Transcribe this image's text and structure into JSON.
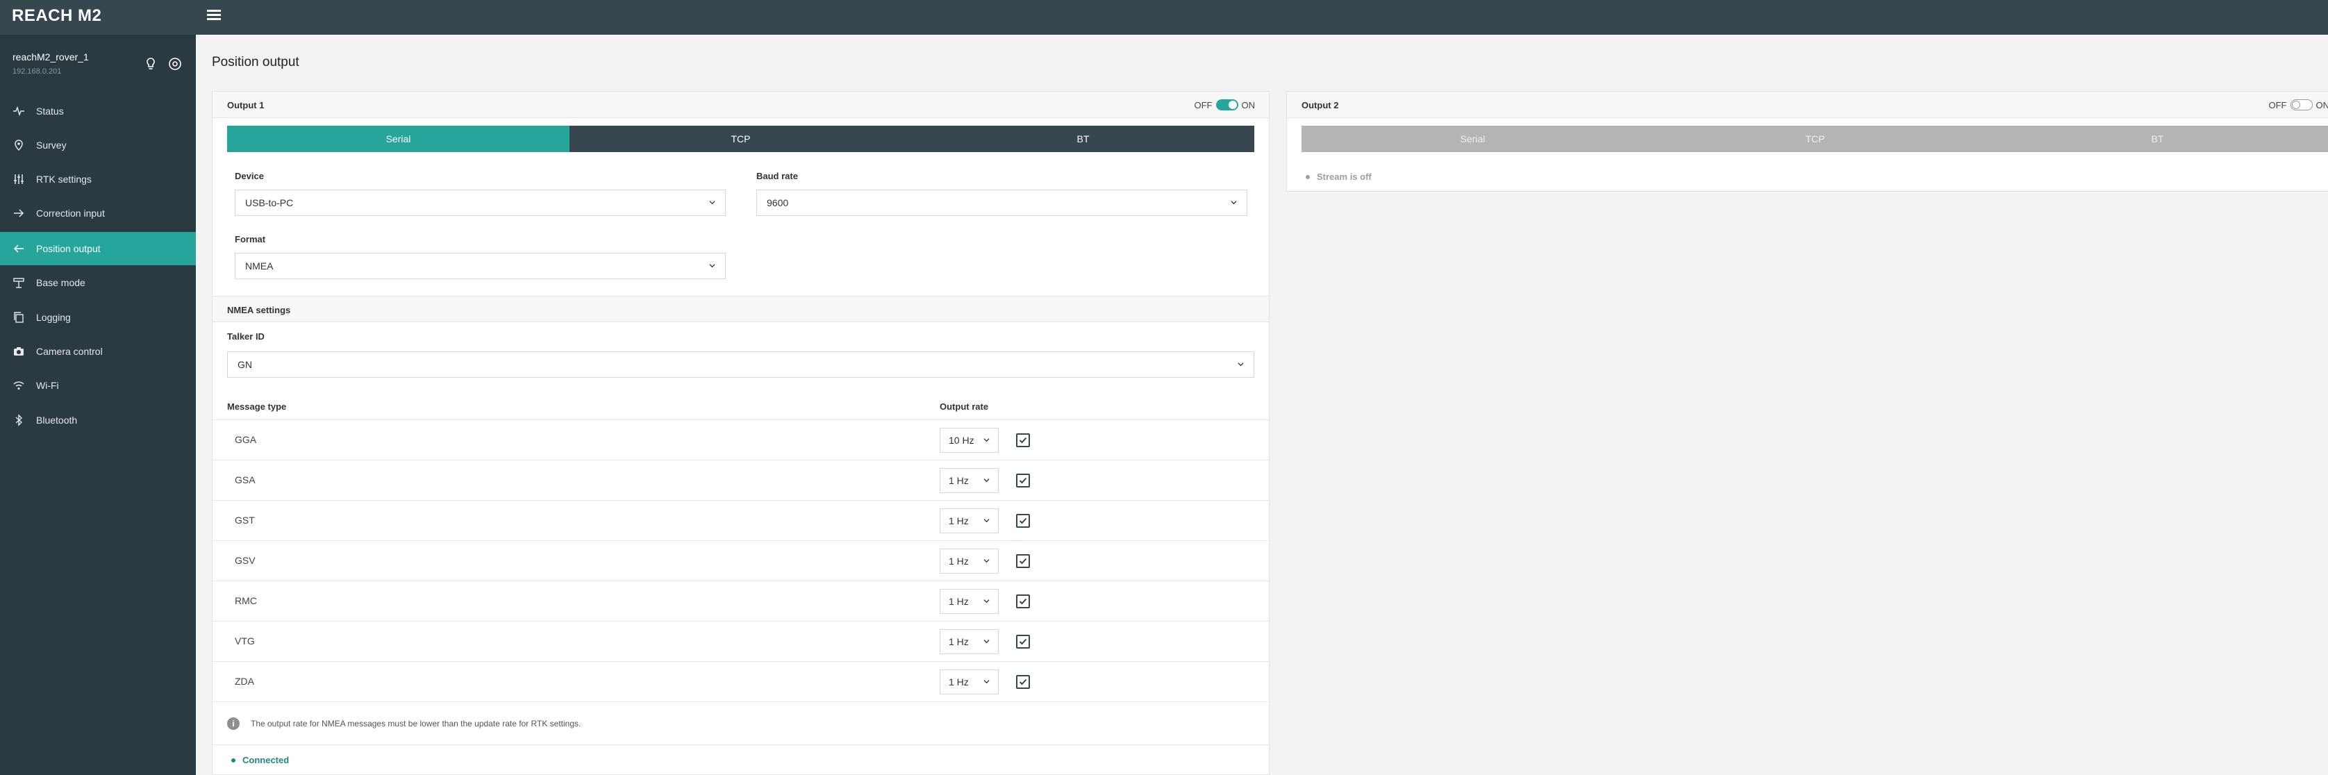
{
  "app": {
    "brand": "REACH M2"
  },
  "device": {
    "name": "reachM2_rover_1",
    "ip": "192.168.0.201"
  },
  "sidebar": {
    "items": [
      {
        "label": "Status",
        "icon": "pulse-icon"
      },
      {
        "label": "Survey",
        "icon": "map-pin-icon"
      },
      {
        "label": "RTK settings",
        "icon": "sliders-icon"
      },
      {
        "label": "Correction input",
        "icon": "arrow-right-icon"
      },
      {
        "label": "Position output",
        "icon": "arrow-left-icon",
        "active": true
      },
      {
        "label": "Base mode",
        "icon": "antenna-icon"
      },
      {
        "label": "Logging",
        "icon": "copy-icon"
      },
      {
        "label": "Camera control",
        "icon": "camera-icon"
      },
      {
        "label": "Wi-Fi",
        "icon": "wifi-icon"
      },
      {
        "label": "Bluetooth",
        "icon": "bluetooth-icon"
      }
    ]
  },
  "main": {
    "title": "Position output"
  },
  "output1": {
    "title": "Output 1",
    "toggle": {
      "off_label": "OFF",
      "on_label": "ON",
      "state": "on"
    },
    "tabs": [
      {
        "label": "Serial",
        "active": true
      },
      {
        "label": "TCP"
      },
      {
        "label": "BT"
      }
    ],
    "device_label": "Device",
    "device_value": "USB-to-PC",
    "baud_label": "Baud rate",
    "baud_value": "9600",
    "format_label": "Format",
    "format_value": "NMEA",
    "nmea_title": "NMEA settings",
    "talker_label": "Talker ID",
    "talker_value": "GN",
    "col_message": "Message type",
    "col_rate": "Output rate",
    "messages": [
      {
        "name": "GGA",
        "rate": "10 Hz",
        "enabled": true
      },
      {
        "name": "GSA",
        "rate": "1 Hz",
        "enabled": true
      },
      {
        "name": "GST",
        "rate": "1 Hz",
        "enabled": true
      },
      {
        "name": "GSV",
        "rate": "1 Hz",
        "enabled": true
      },
      {
        "name": "RMC",
        "rate": "1 Hz",
        "enabled": true
      },
      {
        "name": "VTG",
        "rate": "1 Hz",
        "enabled": true
      },
      {
        "name": "ZDA",
        "rate": "1 Hz",
        "enabled": true
      }
    ],
    "note": "The output rate for NMEA messages must be lower than the update rate for RTK settings.",
    "status": "Connected"
  },
  "output2": {
    "title": "Output 2",
    "toggle": {
      "off_label": "OFF",
      "on_label": "ON",
      "state": "off"
    },
    "tabs": [
      {
        "label": "Serial"
      },
      {
        "label": "TCP"
      },
      {
        "label": "BT"
      }
    ],
    "status": "Stream is off"
  },
  "colors": {
    "accent": "#26a69a",
    "topbar": "#37474f",
    "sidebar": "#2b3a40",
    "tab_dark": "#37474f",
    "tab_disabled": "#b0b0b0",
    "status_ok": "#1e8a7a",
    "status_off": "#9e9e9e"
  }
}
